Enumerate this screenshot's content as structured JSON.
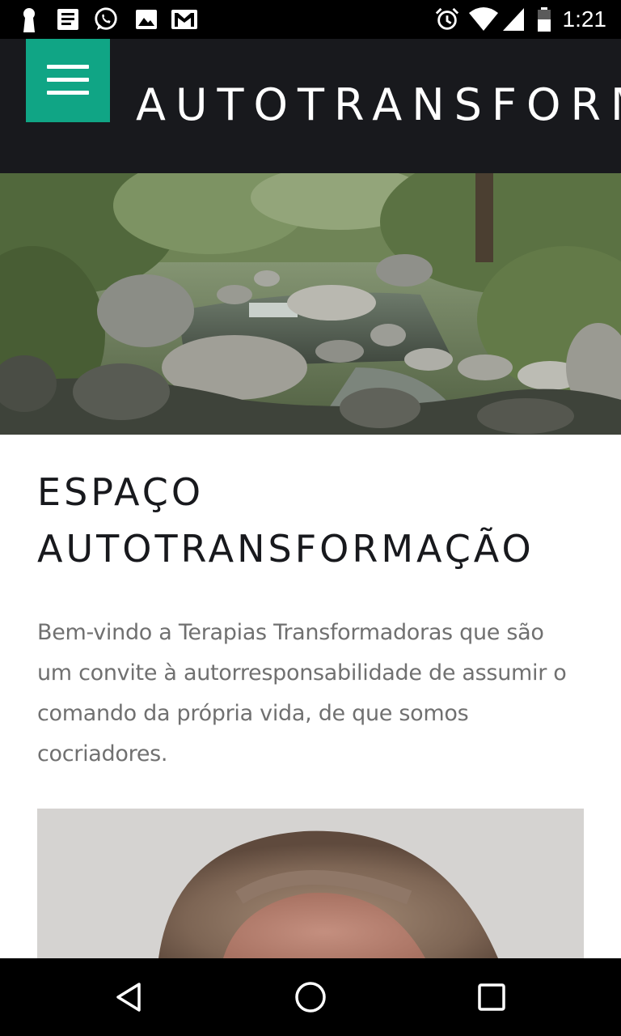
{
  "status_bar": {
    "time": "1:21",
    "left_icons": [
      "keyhole-icon",
      "news-icon",
      "whatsapp-icon",
      "image-icon",
      "gmail-icon"
    ],
    "right_icons": [
      "alarm-icon",
      "wifi-icon",
      "signal-icon",
      "battery-icon"
    ]
  },
  "header": {
    "site_title": "AUTOTRANSFORMAÇÃO",
    "menu_icon": "hamburger-menu-icon",
    "accent_color": "#10a585",
    "background_color": "#18191d"
  },
  "hero": {
    "image": "forest-stream-photo"
  },
  "main": {
    "title": "ESPAÇO AUTOTRANSFORMAÇÃO",
    "intro": "Bem-vindo a Terapias Transformadoras que são um convite à autorresponsabilidade de assumir o comando da própria vida, de que somos cocriadores.",
    "portrait_image": "woman-portrait-photo"
  },
  "nav_bar": {
    "buttons": [
      "back-icon",
      "home-icon",
      "recents-icon"
    ]
  }
}
